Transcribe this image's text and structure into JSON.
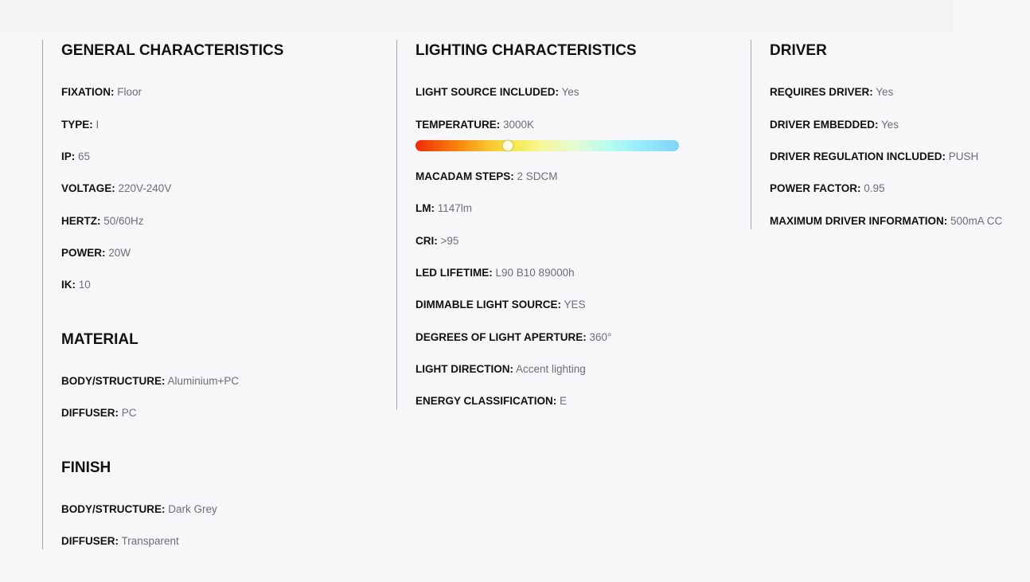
{
  "general": {
    "title": "GENERAL CHARACTERISTICS",
    "rows": [
      {
        "label": "FIXATION:",
        "value": "Floor"
      },
      {
        "label": "TYPE:",
        "value": "I"
      },
      {
        "label": "IP:",
        "value": "65"
      },
      {
        "label": "VOLTAGE:",
        "value": "220V-240V"
      },
      {
        "label": "HERTZ:",
        "value": "50/60Hz"
      },
      {
        "label": "POWER:",
        "value": "20W"
      },
      {
        "label": "IK:",
        "value": "10"
      }
    ]
  },
  "material": {
    "title": "MATERIAL",
    "rows": [
      {
        "label": "BODY/STRUCTURE:",
        "value": "Aluminium+PC"
      },
      {
        "label": "DIFFUSER:",
        "value": "PC"
      }
    ]
  },
  "finish": {
    "title": "FINISH",
    "rows": [
      {
        "label": "BODY/STRUCTURE:",
        "value": "Dark Grey"
      },
      {
        "label": "DIFFUSER:",
        "value": "Transparent"
      }
    ]
  },
  "lighting": {
    "title": "LIGHTING CHARACTERISTICS",
    "rows": [
      {
        "label": "LIGHT SOURCE INCLUDED:",
        "value": "Yes"
      },
      {
        "label": "TEMPERATURE:",
        "value": "3000K"
      },
      {
        "label": "MACADAM STEPS:",
        "value": "2 SDCM"
      },
      {
        "label": "LM:",
        "value": "1147lm"
      },
      {
        "label": "CRI:",
        "value": ">95"
      },
      {
        "label": "LED LIFETIME:",
        "value": "L90 B10 89000h"
      },
      {
        "label": "DIMMABLE LIGHT SOURCE:",
        "value": "YES"
      },
      {
        "label": "DEGREES OF LIGHT APERTURE:",
        "value": "360°"
      },
      {
        "label": "LIGHT DIRECTION:",
        "value": "Accent lighting"
      },
      {
        "label": "ENERGY CLASSIFICATION:",
        "value": "E"
      }
    ],
    "temperature_scale_position": 0.35
  },
  "driver": {
    "title": "DRIVER",
    "rows": [
      {
        "label": "REQUIRES DRIVER:",
        "value": "Yes"
      },
      {
        "label": "DRIVER EMBEDDED:",
        "value": "Yes"
      },
      {
        "label": "DRIVER REGULATION INCLUDED:",
        "value": "PUSH"
      },
      {
        "label": "POWER FACTOR:",
        "value": "0.95"
      },
      {
        "label": "MAXIMUM DRIVER INFORMATION:",
        "value": "500mA CC"
      }
    ]
  }
}
